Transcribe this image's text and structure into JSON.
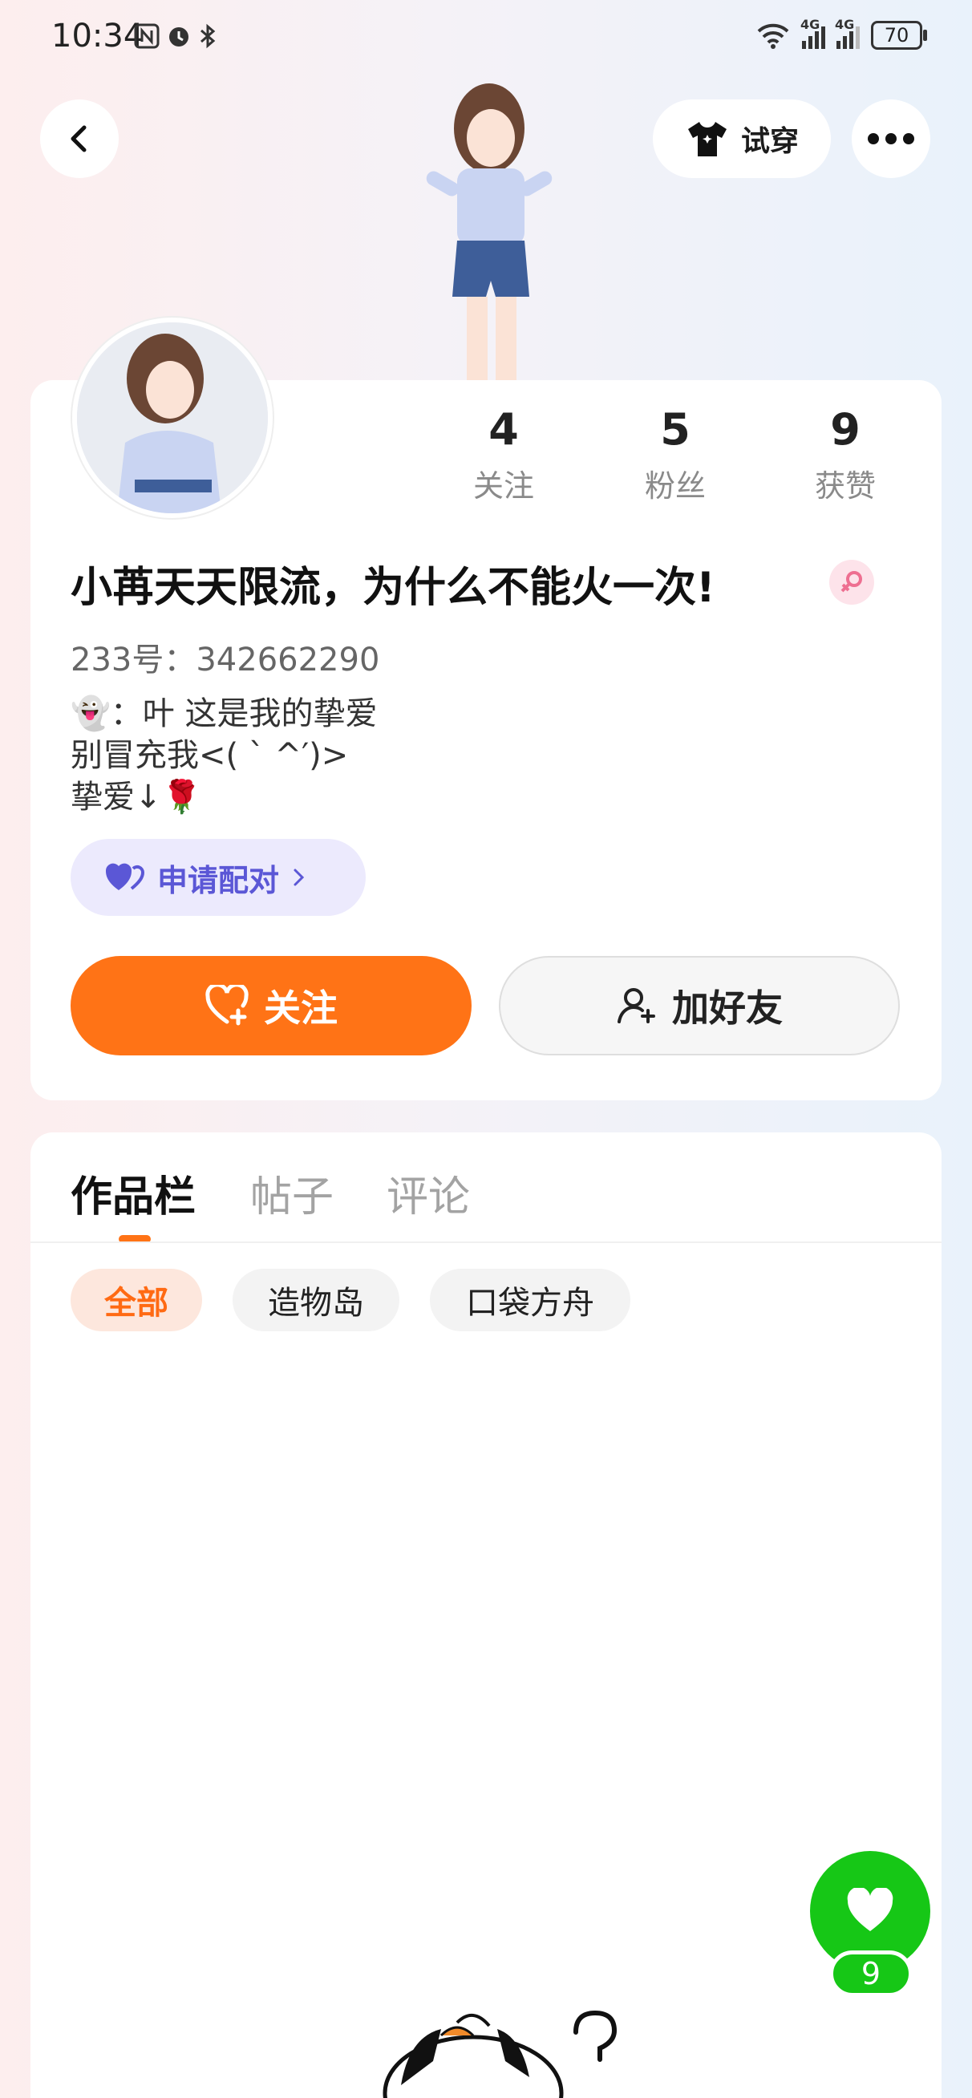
{
  "status_bar": {
    "time": "10:34",
    "network_1": "4G",
    "network_2": "4G",
    "battery": "70"
  },
  "header": {
    "try_on_label": "试穿",
    "back_icon": "chevron-left-icon",
    "more_icon": "more-dots-icon",
    "try_on_icon": "tshirt-icon"
  },
  "profile": {
    "stats": [
      {
        "count": "4",
        "label": "关注"
      },
      {
        "count": "5",
        "label": "粉丝"
      },
      {
        "count": "9",
        "label": "获赞"
      }
    ],
    "name": "小苒天天限流，为什么不能火一次!",
    "uid": "233号：342662290",
    "bio_lines": [
      "👻：叶 这是我的挚爱",
      "别冒充我<( ` ^′)>",
      "挚爱↓🌹"
    ],
    "pair_button": "申请配对",
    "follow_button": "关注",
    "add_friend_button": "加好友"
  },
  "tabs": [
    "作品栏",
    "帖子",
    "评论"
  ],
  "filter_chips": [
    "全部",
    "造物岛",
    "口袋方舟"
  ],
  "like_fab": {
    "count": "9"
  },
  "colors": {
    "accent": "#ff7316",
    "pair_purple": "#5b57d6",
    "like_green": "#16c716"
  }
}
